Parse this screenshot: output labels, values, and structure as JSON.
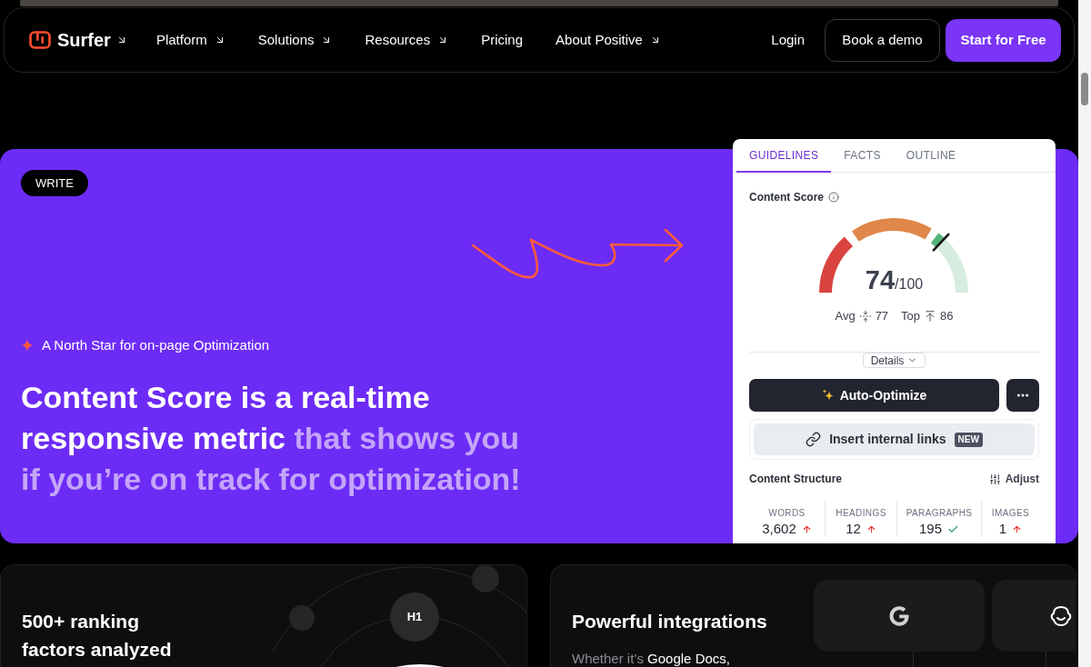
{
  "nav": {
    "logo": {
      "name": "Surfer",
      "has_submenu": true
    },
    "items": [
      {
        "label": "Platform",
        "has_submenu": true
      },
      {
        "label": "Solutions",
        "has_submenu": true
      },
      {
        "label": "Resources",
        "has_submenu": true
      },
      {
        "label": "Pricing",
        "has_submenu": false
      },
      {
        "label": "About Positive",
        "has_submenu": true
      }
    ],
    "login": "Login",
    "demo_button": "Book a demo",
    "cta_button": "Start for Free"
  },
  "hero": {
    "tag": "WRITE",
    "eyebrow": "A North Star for on-page Optimization",
    "headline": {
      "emphasis": "Content Score is a real-time responsive metric",
      "rest": "that shows you if you’re on track for optimization!"
    }
  },
  "panel": {
    "tabs": [
      {
        "label": "GUIDELINES",
        "selected": true
      },
      {
        "label": "FACTS",
        "selected": false
      },
      {
        "label": "OUTLINE",
        "selected": false
      }
    ],
    "score_title": "Content Score",
    "score": {
      "value": "74",
      "max": "/100",
      "level": 0.74
    },
    "benchmarks": [
      {
        "kind": "average",
        "label": "Avg",
        "value": "77"
      },
      {
        "kind": "top",
        "label": "Top",
        "value": "86"
      }
    ],
    "details_button": "Details",
    "auto_optimize_button": "Auto-Optimize",
    "insert_links_button": {
      "label": "Insert internal links",
      "badge": "NEW"
    },
    "structure_title": "Content Structure",
    "adjust_button": "Adjust",
    "stats": [
      {
        "label": "WORDS",
        "value": "3,602",
        "target_met": false
      },
      {
        "label": "HEADINGS",
        "value": "12",
        "target_met": false
      },
      {
        "label": "PARAGRAPHS",
        "value": "195",
        "target_met": true
      },
      {
        "label": "IMAGES",
        "value": "1",
        "target_met": false
      }
    ]
  },
  "features": [
    {
      "kind": "ranking",
      "title": "500+ ranking factors analyzed",
      "node": "H1"
    },
    {
      "kind": "integrations",
      "title": "Powerful integrations",
      "intro": "Whether it’s",
      "highlight": "Google Docs,"
    }
  ]
}
